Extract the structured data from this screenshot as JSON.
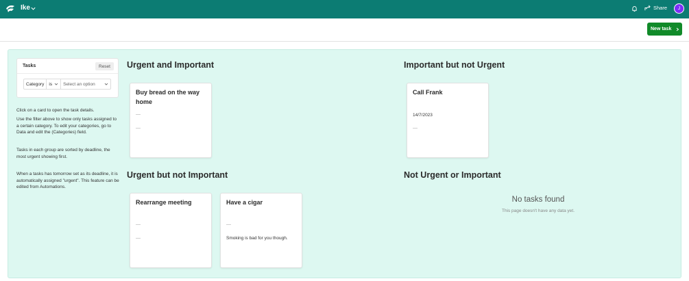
{
  "topbar": {
    "app_name": "Ike",
    "share_label": "Share",
    "avatar_initial": "J",
    "bg_color": "#0c7c73",
    "avatar_color": "#7b2ff7"
  },
  "actions": {
    "new_task_label": "New task",
    "button_color": "#118a29"
  },
  "filter": {
    "title": "Tasks",
    "reset_label": "Reset",
    "field": "Category",
    "operator": "is",
    "value_placeholder": "Select an option"
  },
  "help": [
    "Click on a card to open the task details.",
    "Use the filter above to show only tasks assigned to a certain category.  To edit your categories, go to Data and edit the (Categories) field.",
    "Tasks in each group are sorted by deadline, the most urgent showing first.",
    "When a tasks has tomorrow set as its deadline, it is automatically assigned \"urgent\".  This feature can be edited from Automations."
  ],
  "sections": {
    "urgent_important": {
      "title": "Urgent and Important",
      "cards": [
        {
          "title": "Buy bread on the way home"
        }
      ]
    },
    "important_not_urgent": {
      "title": "Important but not Urgent",
      "cards": [
        {
          "title": "Call Frank",
          "date": "14/7/2023"
        }
      ]
    },
    "urgent_not_important": {
      "title": "Urgent but not Important",
      "cards": [
        {
          "title": "Rearrange meeting"
        },
        {
          "title": "Have a cigar",
          "note": "Smoking is bad for you though."
        }
      ]
    },
    "not_urgent_not_important": {
      "title": "Not Urgent or Important",
      "empty_title": "No tasks found",
      "empty_subtitle": "This page doesn't have any data yet."
    }
  },
  "canvas_color": "#ddf8f1"
}
